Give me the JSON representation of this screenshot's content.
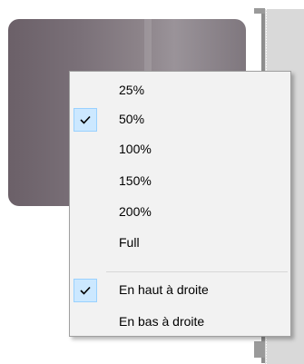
{
  "menu": {
    "items": [
      {
        "label": "25%",
        "checked": false
      },
      {
        "label": "50%",
        "checked": true
      },
      {
        "label": "100%",
        "checked": false
      },
      {
        "label": "150%",
        "checked": false
      },
      {
        "label": "200%",
        "checked": false
      },
      {
        "label": "Full",
        "checked": false
      },
      {
        "label": "En haut à droite",
        "checked": true
      },
      {
        "label": "En bas à droite",
        "checked": false
      }
    ],
    "check_icon": "checkmark-icon"
  },
  "colors": {
    "menu_bg": "#f2f2f2",
    "check_highlight": "#cce8ff",
    "check_border": "#99d1ff"
  }
}
